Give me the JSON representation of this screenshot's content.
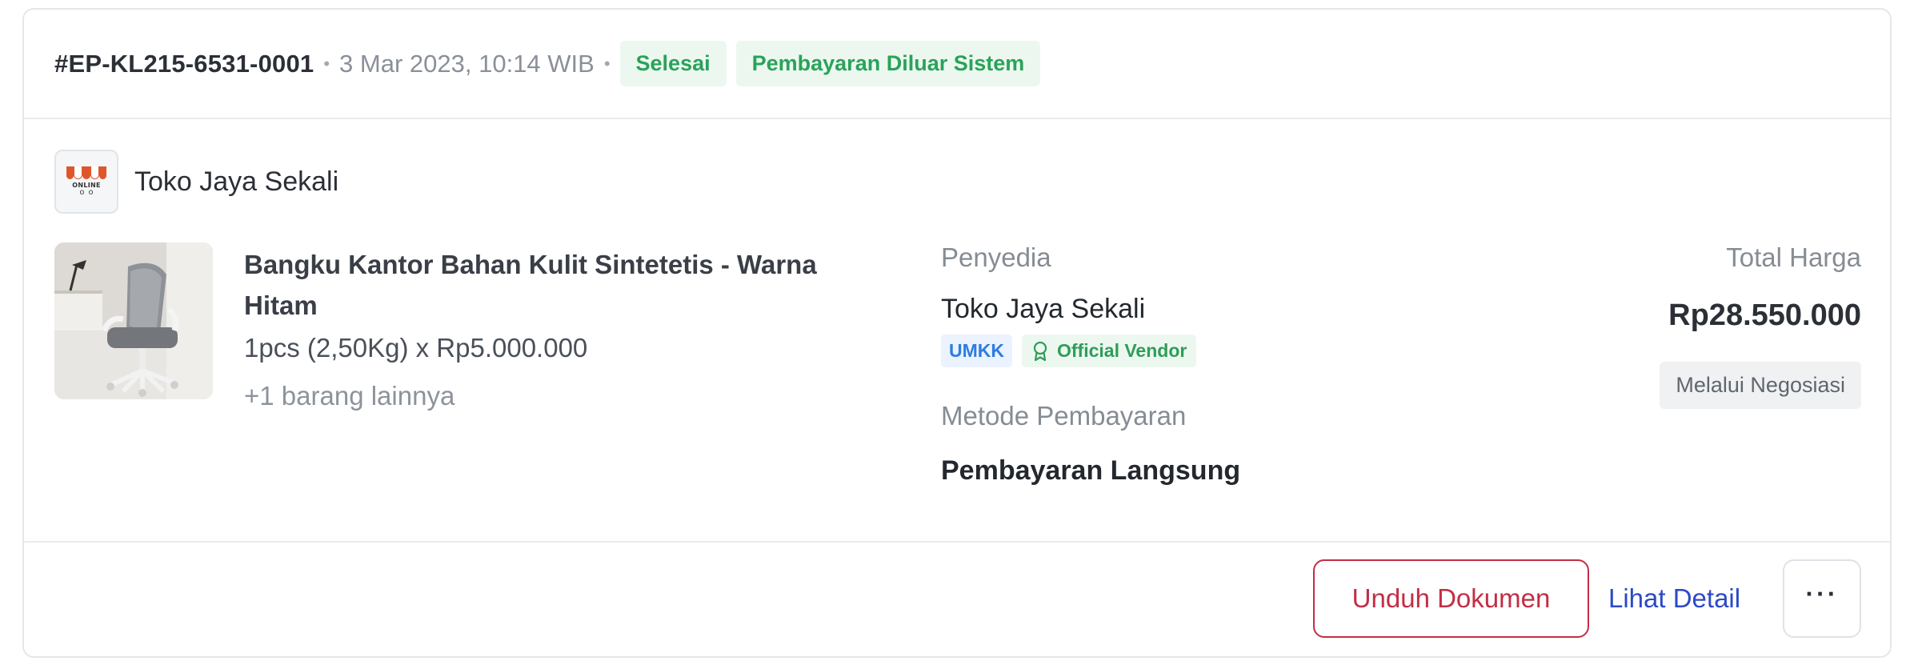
{
  "order": {
    "id": "#EP-KL215-6531-0001",
    "date": "3 Mar 2023, 10:14 WIB",
    "separator": "•",
    "status": "Selesai",
    "payment_badge": "Pembayaran Diluar Sistem"
  },
  "store": {
    "name": "Toko Jaya Sekali",
    "logo_text": "ONLINE",
    "logo_icon": "online-shop-logo-icon"
  },
  "product": {
    "name": "Bangku Kantor Bahan Kulit Sintetetis - Warna Hitam",
    "quantity": "1pcs (2,50Kg) x Rp5.000.000",
    "more_items": "+1 barang lainnya",
    "image_icon": "office-chair-image"
  },
  "vendor": {
    "label": "Penyedia",
    "name": "Toko Jaya Sekali",
    "badge_umkk": "UMKK",
    "badge_official": "Official Vendor",
    "official_icon": "medal-icon"
  },
  "payment": {
    "label": "Metode Pembayaran",
    "method": "Pembayaran Langsung"
  },
  "price": {
    "label": "Total Harga",
    "total": "Rp28.550.000",
    "badge": "Melalui Negosiasi"
  },
  "actions": {
    "download_label": "Unduh Dokumen",
    "detail_label": "Lihat Detail",
    "more_icon": "more-horizontal-icon"
  },
  "colors": {
    "status_green": "#29a35a",
    "brand_red": "#c22e45",
    "link_blue": "#2c49c7",
    "umkk_blue": "#2e7ce0"
  }
}
